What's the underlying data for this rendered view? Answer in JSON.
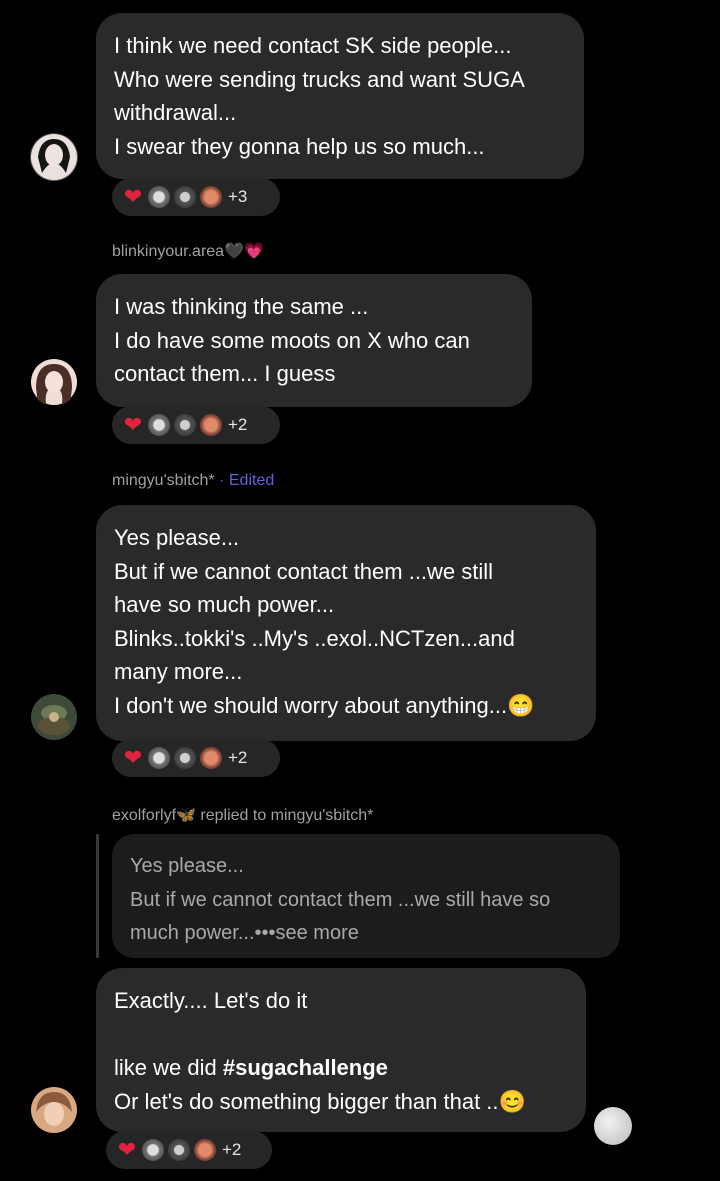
{
  "messages": [
    {
      "username": "",
      "lines": [
        "I think we need contact SK side people...",
        "Who were sending trucks and want SUGA",
        "withdrawal...",
        "I swear they gonna help us so much..."
      ],
      "reaction_count": "+3"
    },
    {
      "username": "blinkinyour.area",
      "username_suffix": "🖤💗",
      "lines": [
        "I was thinking the same ...",
        "I do have some moots on X who can",
        "contact them... I guess"
      ],
      "reaction_count": "+2"
    },
    {
      "username": "mingyu'sbitch*",
      "edited_label": "· Edited",
      "lines": [
        "Yes please...",
        "But if we cannot contact them ...we still",
        "have so much power...",
        "Blinks..tokki's ..My's ..exol..NCTzen...and",
        "many more...",
        "I don't we should worry about anything...😁"
      ],
      "reaction_count": "+2"
    },
    {
      "username": "exolforlyf",
      "username_suffix": "🦋",
      "reply_label": "replied to mingyu'sbitch*",
      "quote_lines": [
        "Yes please...",
        "But if we cannot contact them ...we still have so",
        "much power...•••see more"
      ],
      "line1": "Exactly.... Let's do it",
      "line2_prefix": "like we did ",
      "hashtag": "#sugachallenge",
      "line3": "Or let's do something bigger than that ..😊",
      "reaction_count": "+2"
    }
  ],
  "reaction_heart": "❤",
  "colors": {
    "background": "#000000",
    "bubble": "#2a2a2a",
    "quote": "#1c1c1c",
    "edited": "#5b63d6",
    "heart": "#e0243b"
  }
}
